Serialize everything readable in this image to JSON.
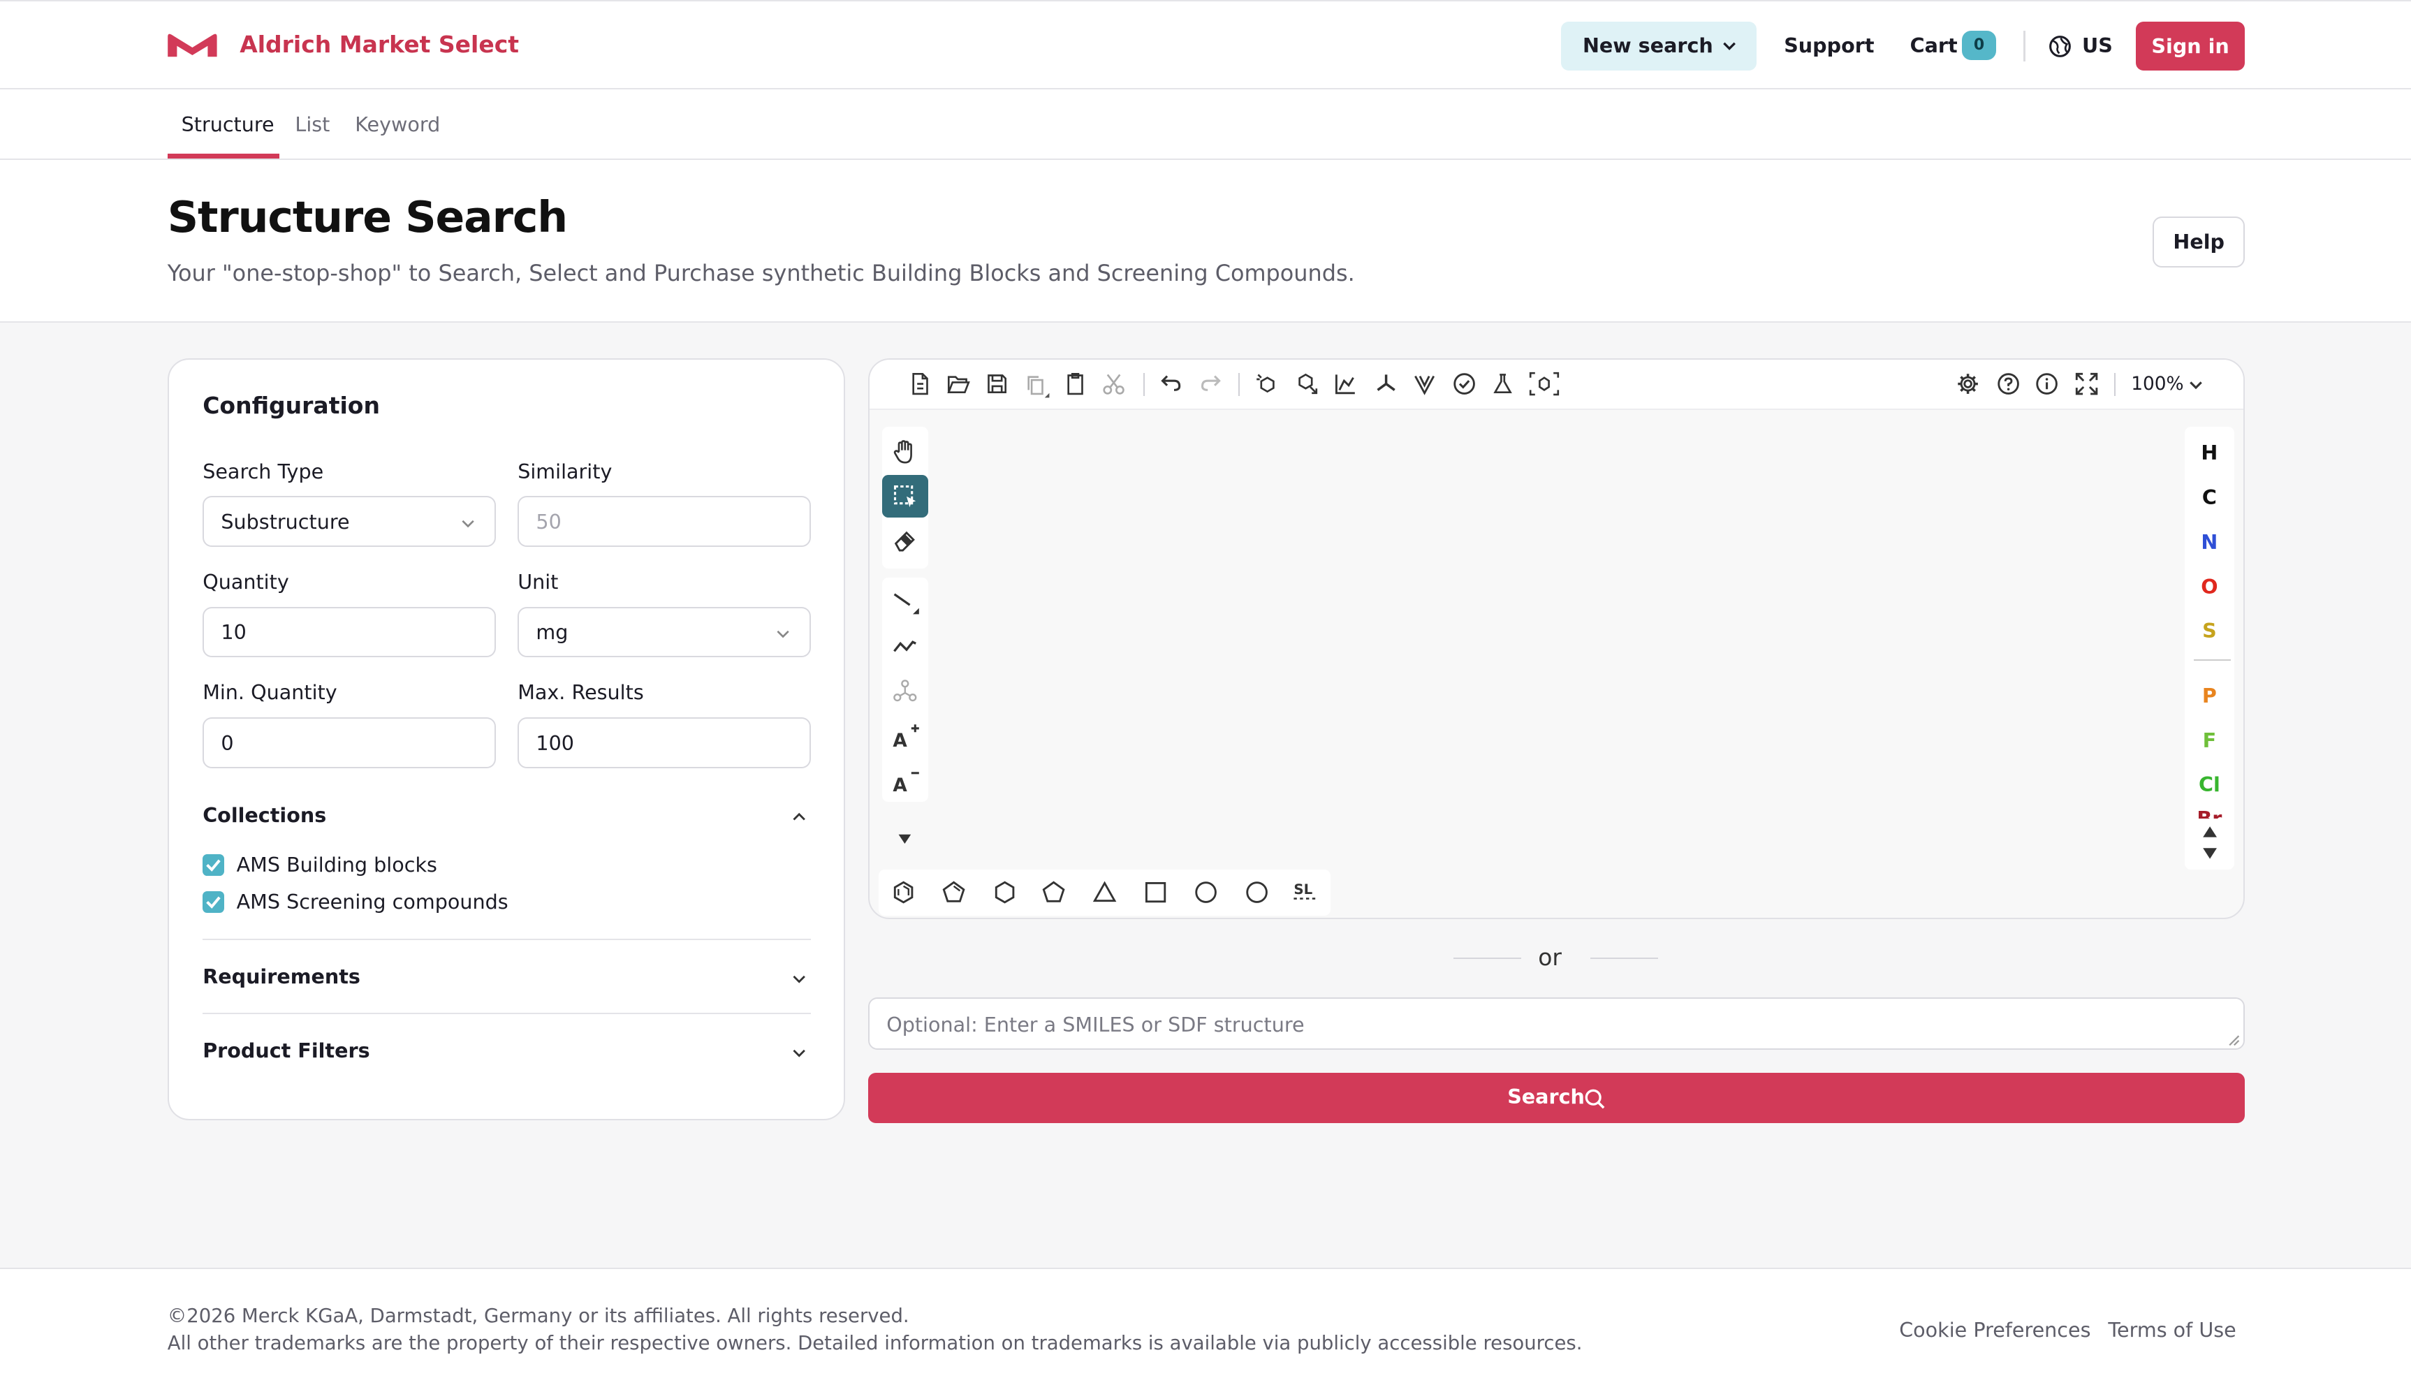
{
  "header": {
    "brand": "Aldrich Market Select",
    "new_search": "New search",
    "support": "Support",
    "cart": "Cart",
    "cart_count": "0",
    "region": "US",
    "sign_in": "Sign in"
  },
  "tabs": [
    {
      "label": "Structure",
      "active": true
    },
    {
      "label": "List",
      "active": false
    },
    {
      "label": "Keyword",
      "active": false
    }
  ],
  "page": {
    "title": "Structure Search",
    "subtitle": "Your \"one-stop-shop\" to Search, Select and Purchase synthetic Building Blocks and Screening Compounds.",
    "help": "Help"
  },
  "config": {
    "title": "Configuration",
    "search_type": {
      "label": "Search Type",
      "value": "Substructure"
    },
    "similarity": {
      "label": "Similarity",
      "placeholder": "50"
    },
    "quantity": {
      "label": "Quantity",
      "value": "10"
    },
    "unit": {
      "label": "Unit",
      "value": "mg"
    },
    "min_quantity": {
      "label": "Min. Quantity",
      "value": "0"
    },
    "max_results": {
      "label": "Max. Results",
      "value": "100"
    },
    "collections": {
      "title": "Collections",
      "items": [
        {
          "label": "AMS Building blocks",
          "checked": true
        },
        {
          "label": "AMS Screening compounds",
          "checked": true
        }
      ]
    },
    "requirements": "Requirements",
    "product_filters": "Product Filters"
  },
  "editor": {
    "zoom": "100%",
    "elements": [
      {
        "symbol": "H",
        "color": "#111111"
      },
      {
        "symbol": "C",
        "color": "#111111"
      },
      {
        "symbol": "N",
        "color": "#2f4fd6"
      },
      {
        "symbol": "O",
        "color": "#e0281e"
      },
      {
        "symbol": "S",
        "color": "#c6a31d"
      },
      {
        "symbol": "P",
        "color": "#e8841e"
      },
      {
        "symbol": "F",
        "color": "#6fbf3a"
      },
      {
        "symbol": "Cl",
        "color": "#38b52f"
      },
      {
        "symbol": "Br",
        "color": "#a61d2a"
      }
    ],
    "template_label": "SL"
  },
  "search": {
    "or": "or",
    "placeholder": "Optional: Enter a SMILES or SDF structure",
    "button": "Search"
  },
  "footer": {
    "copyright": "©2026 Merck KGaA, Darmstadt, Germany or its affiliates. All rights reserved.",
    "trademarks": "All other trademarks are the property of their respective owners. Detailed information on trademarks is available via publicly accessible resources.",
    "cookie": "Cookie Preferences",
    "terms": "Terms of Use"
  }
}
